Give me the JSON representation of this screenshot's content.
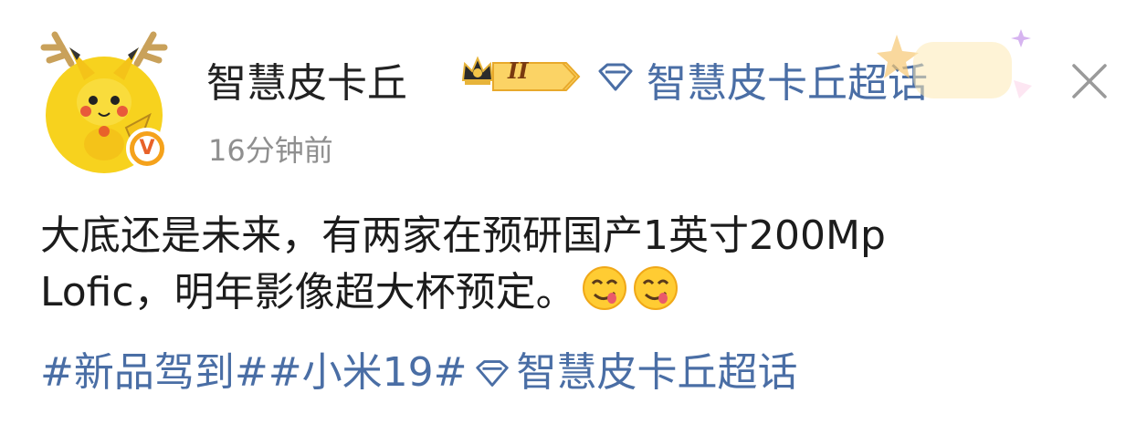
{
  "user": {
    "name": "智慧皮卡丘",
    "level": "II",
    "verified_mark": "V"
  },
  "supertopic": {
    "label": "智慧皮卡丘超话"
  },
  "post": {
    "timestamp": "16分钟前",
    "line1": "大底还是未来，有两家在预研国产1英寸200Mp",
    "line2": "Lofic，明年影像超大杯预定。"
  },
  "tags": {
    "tag1": "#新品驾到#",
    "tag2": "#小米19#",
    "tag3": "智慧皮卡丘超话"
  },
  "icons": {
    "avatar": "pikachu-avatar",
    "crown": "crown-icon",
    "supertopic": "diamond-icon",
    "emoji": "drooling-face-emoji",
    "close": "close-icon"
  },
  "colors": {
    "link": "#4a6ea5",
    "text": "#1c1c1c",
    "muted": "#8f8f8f",
    "avatar_bg": "#f7d21e",
    "badge": "#f5a21b"
  }
}
